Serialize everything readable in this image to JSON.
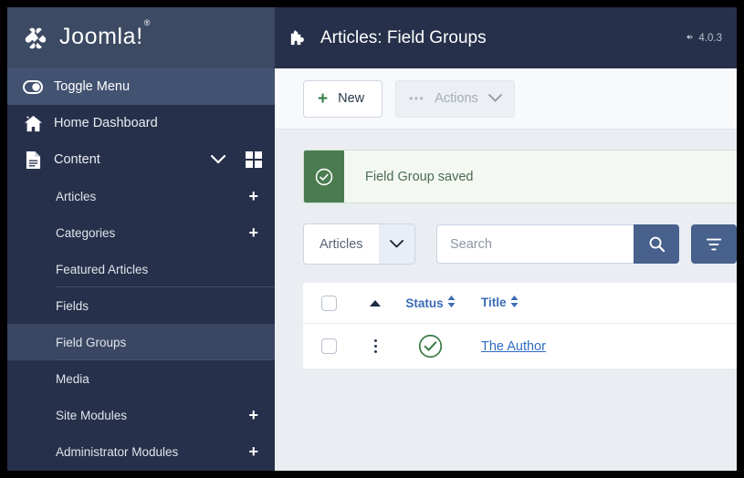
{
  "brand": {
    "name": "Joomla!",
    "trademark": "®"
  },
  "sidebar": {
    "toggle": {
      "label": "Toggle Menu",
      "icon": "toggle-icon"
    },
    "items": [
      {
        "label": "Home Dashboard",
        "icon": "home-icon"
      },
      {
        "label": "Content",
        "icon": "document-icon",
        "expandable": true,
        "grid": true
      }
    ],
    "subitems": [
      {
        "label": "Articles",
        "plus": "+",
        "active": false,
        "divider": false
      },
      {
        "label": "Categories",
        "plus": "+",
        "active": false,
        "divider": false
      },
      {
        "label": "Featured Articles",
        "plus": "",
        "active": false,
        "divider": true
      },
      {
        "label": "Fields",
        "plus": "",
        "active": false,
        "divider": false
      },
      {
        "label": "Field Groups",
        "plus": "",
        "active": true,
        "divider": true
      },
      {
        "label": "Media",
        "plus": "",
        "active": false,
        "divider": false
      },
      {
        "label": "Site Modules",
        "plus": "+",
        "active": false,
        "divider": false
      },
      {
        "label": "Administrator Modules",
        "plus": "+",
        "active": false,
        "divider": false
      }
    ]
  },
  "header": {
    "title": "Articles: Field Groups",
    "icon": "puzzle-piece-icon",
    "version": "4.0.3"
  },
  "toolbar": {
    "new_label": "New",
    "new_plus": "+",
    "actions_label": "Actions",
    "actions_dots": "•••"
  },
  "alert": {
    "message": "Field Group saved",
    "icon": "check-circle-icon",
    "accent_color": "#4b7c50",
    "background_color": "#f3f8f3"
  },
  "filters": {
    "context_select": "Articles",
    "search_placeholder": "Search",
    "search_value": "",
    "search_button_icon": "search-icon",
    "filter_button_icon": "filter-icon",
    "button_color": "#47618c"
  },
  "table": {
    "columns": [
      {
        "key": "checkbox",
        "label": ""
      },
      {
        "key": "ordering",
        "label": ""
      },
      {
        "key": "status",
        "label": "Status",
        "sortable": true
      },
      {
        "key": "title",
        "label": "Title",
        "sortable": true
      }
    ],
    "rows": [
      {
        "title": "The Author",
        "status": "published",
        "status_icon": "check-circle-icon"
      }
    ]
  },
  "colors": {
    "sidebar_bg": "#26304a",
    "sidebar_brand_bg": "#3c4a63",
    "sidebar_active": "#3a4763",
    "topbar_bg": "#26304a",
    "page_bg": "#eaeef3",
    "link": "#2f6cc4",
    "header_link": "#3b6bb5",
    "green": "#36804a"
  }
}
